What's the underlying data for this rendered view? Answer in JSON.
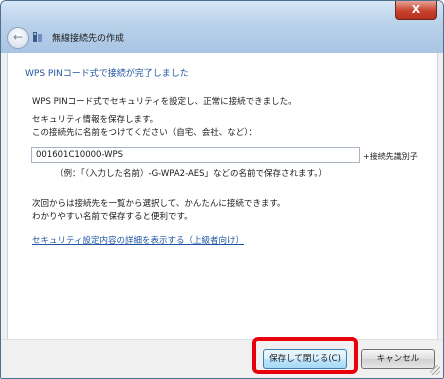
{
  "titlebar": {
    "title": "無線接続先の作成",
    "close_label": "X",
    "back_icon": "back-arrow-icon",
    "network_icon": "network-icon"
  },
  "main": {
    "heading": "WPS PINコード式で接続が完了しました",
    "line1": "WPS PINコード式でセキュリティを設定し、正常に接続できました。",
    "line2": "セキュリティ情報を保存します。",
    "line3": "この接続先に名前をつけてください（自宅、会社、など）：",
    "name_input_value": "001601C10000-WPS",
    "name_input_side_label": "+接続先識別子",
    "example": "（例：「（入力した名前）-G-WPA2-AES」などの名前で保存されます。）",
    "line4": "次回からは接続先を一覧から選択して、かんたんに接続できます。",
    "line5": "わかりやすい名前で保存すると便利です。",
    "details_link": "セキュリティ設定内容の詳細を表示する（上級者向け）"
  },
  "footer": {
    "save_label": "保存して閉じる(C)",
    "cancel_label": "キャンセル"
  },
  "colors": {
    "heading": "#1f55a0",
    "highlight": "#e8000d",
    "titlebar": "#b9d1ea"
  }
}
